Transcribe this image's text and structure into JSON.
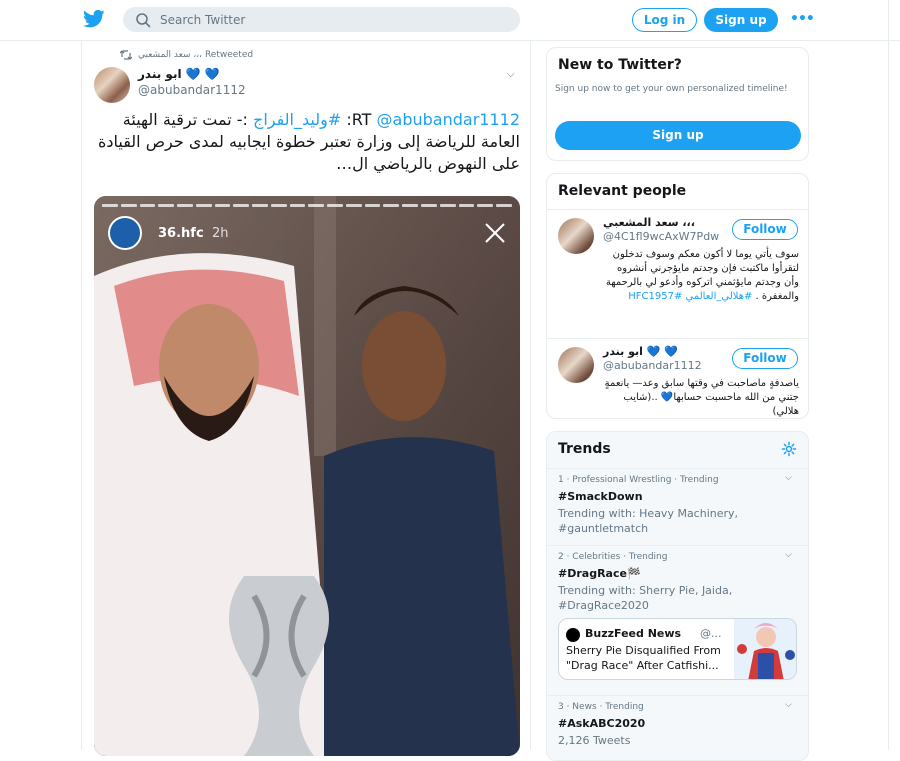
{
  "header": {
    "logo_icon": "twitter-bird-icon",
    "search_placeholder": "Search Twitter",
    "login_label": "Log in",
    "signup_label": "Sign up",
    "more_label": "•••"
  },
  "tweet": {
    "retweet_label": "سعد المشعبي ،،، Retweeted",
    "display_name": "ابو بندر 💙 💙",
    "username": "@abubandar1112",
    "text_prefix": "RT ",
    "mention": "@abubandar1112",
    "separator": ": ",
    "hashtag": "#وليد_الفراج",
    "text_body": " :-  تمت ترقية الهيئة العامة للرياضة إلى وزارة تعتبر  خطوة  ايجابيه لمدى حرص القيادة  على النهوض بالرياضي ال…",
    "story": {
      "user": "36.hfc",
      "time": "2h"
    }
  },
  "new_to_twitter": {
    "title": "New to Twitter?",
    "subtitle": "Sign up now to get your own personalized timeline!",
    "button": "Sign up"
  },
  "relevant_people": {
    "title": "Relevant people",
    "people": [
      {
        "name": "سعد المشعبي ،،،",
        "username": "@4C1fl9wcAxW7Pdw",
        "follow": "Follow",
        "bio": "سوف يأتي يوما لا أكون معكم وسوف تدخلون لتقرأوا ماكتبت فإن وجدتم مايؤجرني أنشروه وأن وجدتم مايؤثمني اتركوه وأدعو لي بالرحمهة والمغفرة . ",
        "bio_hashtag": "#هلالي_العالمي HFC1957#"
      },
      {
        "name": "ابو بندر 💙 💙",
        "username": "@abubandar1112",
        "follow": "Follow",
        "bio": "ياصدفةٍ ماصاحبت في وقتها سابق وعد— يانعمةٍ جتني من الله ماحسبت حسابها💙 ..(شايب هلالي)"
      }
    ]
  },
  "trends": {
    "title": "Trends",
    "items": [
      {
        "meta": "1 · Professional Wrestling · Trending",
        "name": "#SmackDown",
        "desc": "Trending with: Heavy Machinery, #gauntletmatch"
      },
      {
        "meta": "2 · Celebrities · Trending",
        "name": "#DragRace🏁",
        "desc": "Trending with: Sherry Pie, Jaida, #DragRace2020",
        "news": {
          "source": "BuzzFeed News",
          "handle": "@...",
          "headline": "Sherry Pie Disqualified From \"Drag Race\" After Catfishi..."
        }
      },
      {
        "meta": "3 · News · Trending",
        "name": "#AskABC2020",
        "desc": "2,126 Tweets"
      }
    ]
  }
}
